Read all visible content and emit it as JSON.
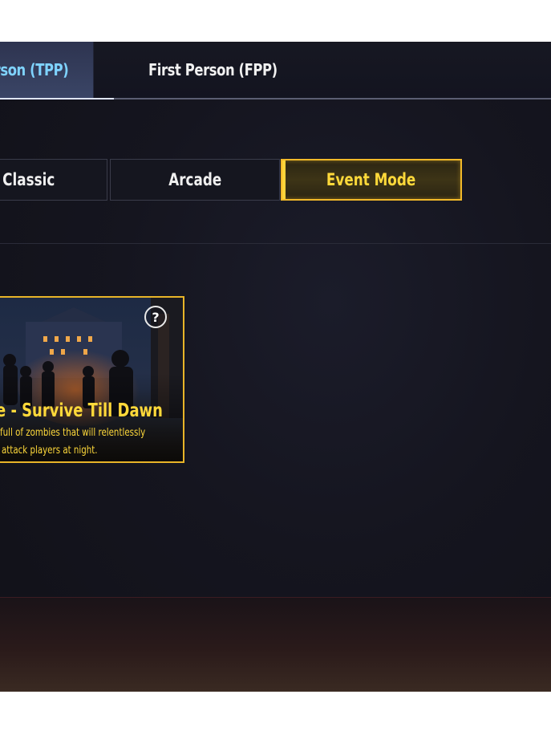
{
  "perspective_tabs": {
    "tpp_label": "Third Person (TPP)",
    "tpp_visible": "erson (TPP)",
    "fpp_label": "First Person (FPP)",
    "selected": "tpp"
  },
  "mode_tabs": {
    "classic_visible": "Classic",
    "arcade": "Arcade",
    "event": "Event Mode",
    "selected": "event"
  },
  "event_card": {
    "title_visible": "ie - Survive Till Dawn",
    "desc_line1_visible": "full of zombies that will relentlessly",
    "desc_line2_visible": "attack players at night.",
    "help_icon": "question-mark-icon",
    "help_glyph": "?"
  },
  "colors": {
    "accent_gold": "#ffd93a",
    "accent_blue": "#7fd3ff",
    "background": "#15151f"
  }
}
